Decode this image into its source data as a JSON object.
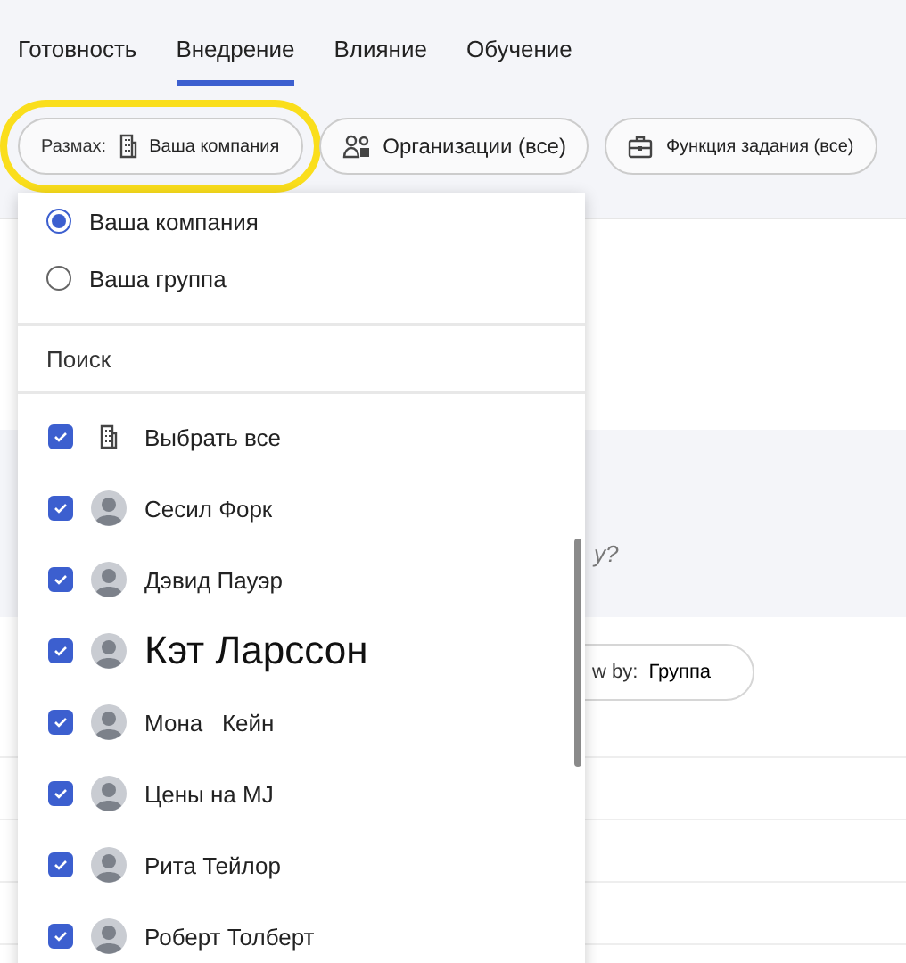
{
  "tabs": [
    {
      "label": "Готовность",
      "selected": false
    },
    {
      "label": "Внедрение",
      "selected": true
    },
    {
      "label": "Влияние",
      "selected": false
    },
    {
      "label": "Обучение",
      "selected": false
    }
  ],
  "filters": [
    {
      "kind": "scope",
      "label": "Размах:",
      "value": "Ваша компания",
      "highlighted": true
    },
    {
      "kind": "orgs",
      "value": "Организации (все)",
      "highlighted": false
    },
    {
      "kind": "job",
      "value": "Функция задания (все)",
      "highlighted": false
    }
  ],
  "background": {
    "question_fragment": "y?",
    "view_by": {
      "label": "w by:",
      "value": "Группа"
    }
  },
  "dropdown": {
    "scope_options": [
      {
        "label": "Ваша компания",
        "selected": true
      },
      {
        "label": "Ваша группа",
        "selected": false
      }
    ],
    "search": {
      "placeholder": "Поиск"
    },
    "items": [
      {
        "kind": "all",
        "label": "Выбрать все",
        "checked": true,
        "large": false
      },
      {
        "kind": "person",
        "label": "Сесил Форк",
        "checked": true,
        "large": false
      },
      {
        "kind": "person",
        "label": "Дэвид Пауэр",
        "checked": true,
        "large": false
      },
      {
        "kind": "person",
        "label": "Кэт Ларссон",
        "checked": true,
        "large": true
      },
      {
        "kind": "person",
        "label": "Мона   Кейн",
        "checked": true,
        "large": false
      },
      {
        "kind": "person",
        "label": "Цены на MJ",
        "checked": true,
        "large": false
      },
      {
        "kind": "person",
        "label": "Рита Тейлор",
        "checked": true,
        "large": false
      },
      {
        "kind": "person",
        "label": "Роберт Толберт",
        "checked": true,
        "large": false
      }
    ]
  }
}
